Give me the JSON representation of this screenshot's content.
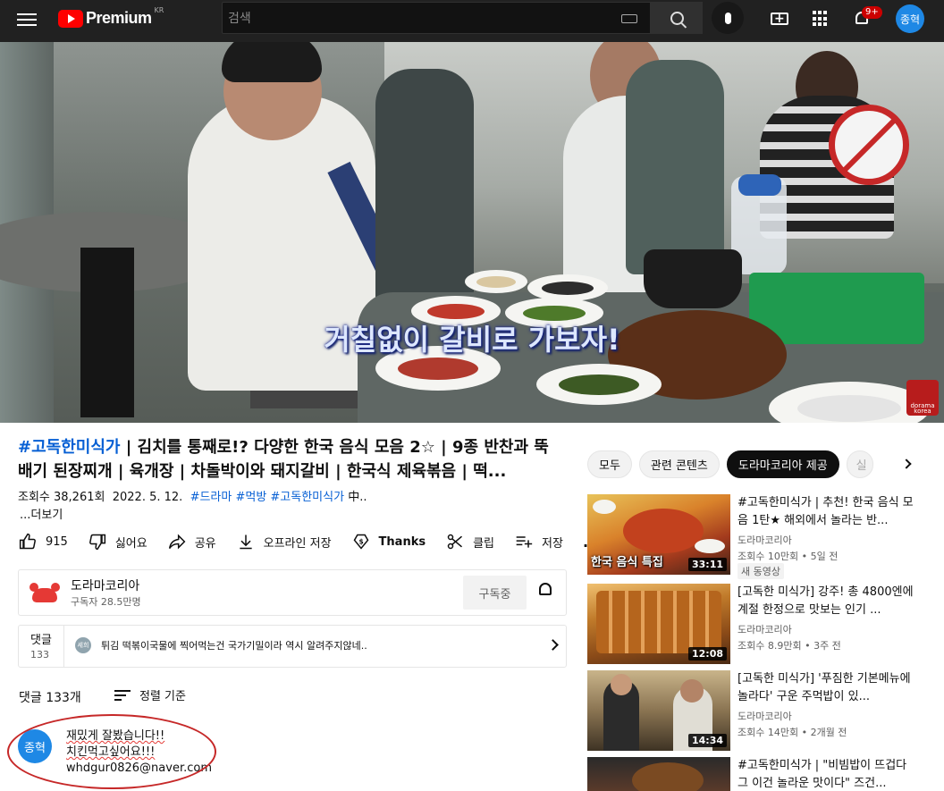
{
  "header": {
    "logo_text": "Premium",
    "logo_region": "KR",
    "search_placeholder": "검색",
    "notifications_badge": "9+",
    "avatar_initials": "종혁"
  },
  "player": {
    "subtitle": "거칠없이 갈비로 가보자!",
    "watermark": "dorama korea"
  },
  "video": {
    "title_hashtag": "#고독한미식가",
    "title_rest": " | 김치를 통째로!? 다양한 한국 음식 모음 2☆ | 9종 반찬과 뚝배기 된장찌개 | 육개장 | 차돌박이와 돼지갈비 | 한국식 제육볶음 | 떡...",
    "views": "조회수 38,261회",
    "date": "2022. 5. 12.",
    "tags": "#드라마 #먹방 #고독한미식가",
    "tags_suffix": "中..",
    "more": "...더보기"
  },
  "actions": {
    "like_count": "915",
    "dislike_label": "싫어요",
    "share_label": "공유",
    "offline_label": "오프라인 저장",
    "thanks_label": "Thanks",
    "clip_label": "클립",
    "save_label": "저장",
    "more_label": "..."
  },
  "channel": {
    "name": "도라마코리아",
    "subscribers": "구독자 28.5만명",
    "subscribe_label": "구독중"
  },
  "comments_preview": {
    "label": "댓글",
    "count": "133",
    "avatar_text": "세희",
    "text": "튀김 떡볶이국물에 찍어먹는건 국가기밀이라 역시 알려주지않네.."
  },
  "comments": {
    "count_label": "댓글 133개",
    "sort_label": "정렬 기준",
    "first": {
      "avatar_text": "종혁",
      "line1": "재밌게 잘봤습니다!!",
      "line2": "치킨먹고싶어요!!!",
      "line3": "whdgur0826@naver.com"
    }
  },
  "chips": [
    "모두",
    "관련 콘텐츠",
    "도라마코리아 제공",
    "실"
  ],
  "recommendations": [
    {
      "title": "#고독한미식가 | 추천! 한국 음식 모음 1탄★ 해외에서 놀라는 반...",
      "channel": "도라마코리아",
      "stats": "조회수 10만회 • 5일 전",
      "badge": "새 동영상",
      "duration": "33:11",
      "caption": "한국 음식 특집"
    },
    {
      "title": "[고독한 미식가] 강주! 총 4800엔에 계절 한정으로 맛보는 인기 ...",
      "channel": "도라마코리아",
      "stats": "조회수 8.9만회 • 3주 전",
      "badge": "",
      "duration": "12:08",
      "caption": ""
    },
    {
      "title": "[고독한 미식가] '푸짐한 기본메뉴에 놀라다' 구운 주먹밥이 있...",
      "channel": "도라마코리아",
      "stats": "조회수 14만회 • 2개월 전",
      "badge": "",
      "duration": "14:34",
      "caption": ""
    },
    {
      "title": "#고독한미식가 | \"비빔밥이 뜨겁다 그 이건 놀라운 맛이다\" 즈건...",
      "channel": "",
      "stats": "",
      "badge": "",
      "duration": "",
      "caption": ""
    }
  ]
}
